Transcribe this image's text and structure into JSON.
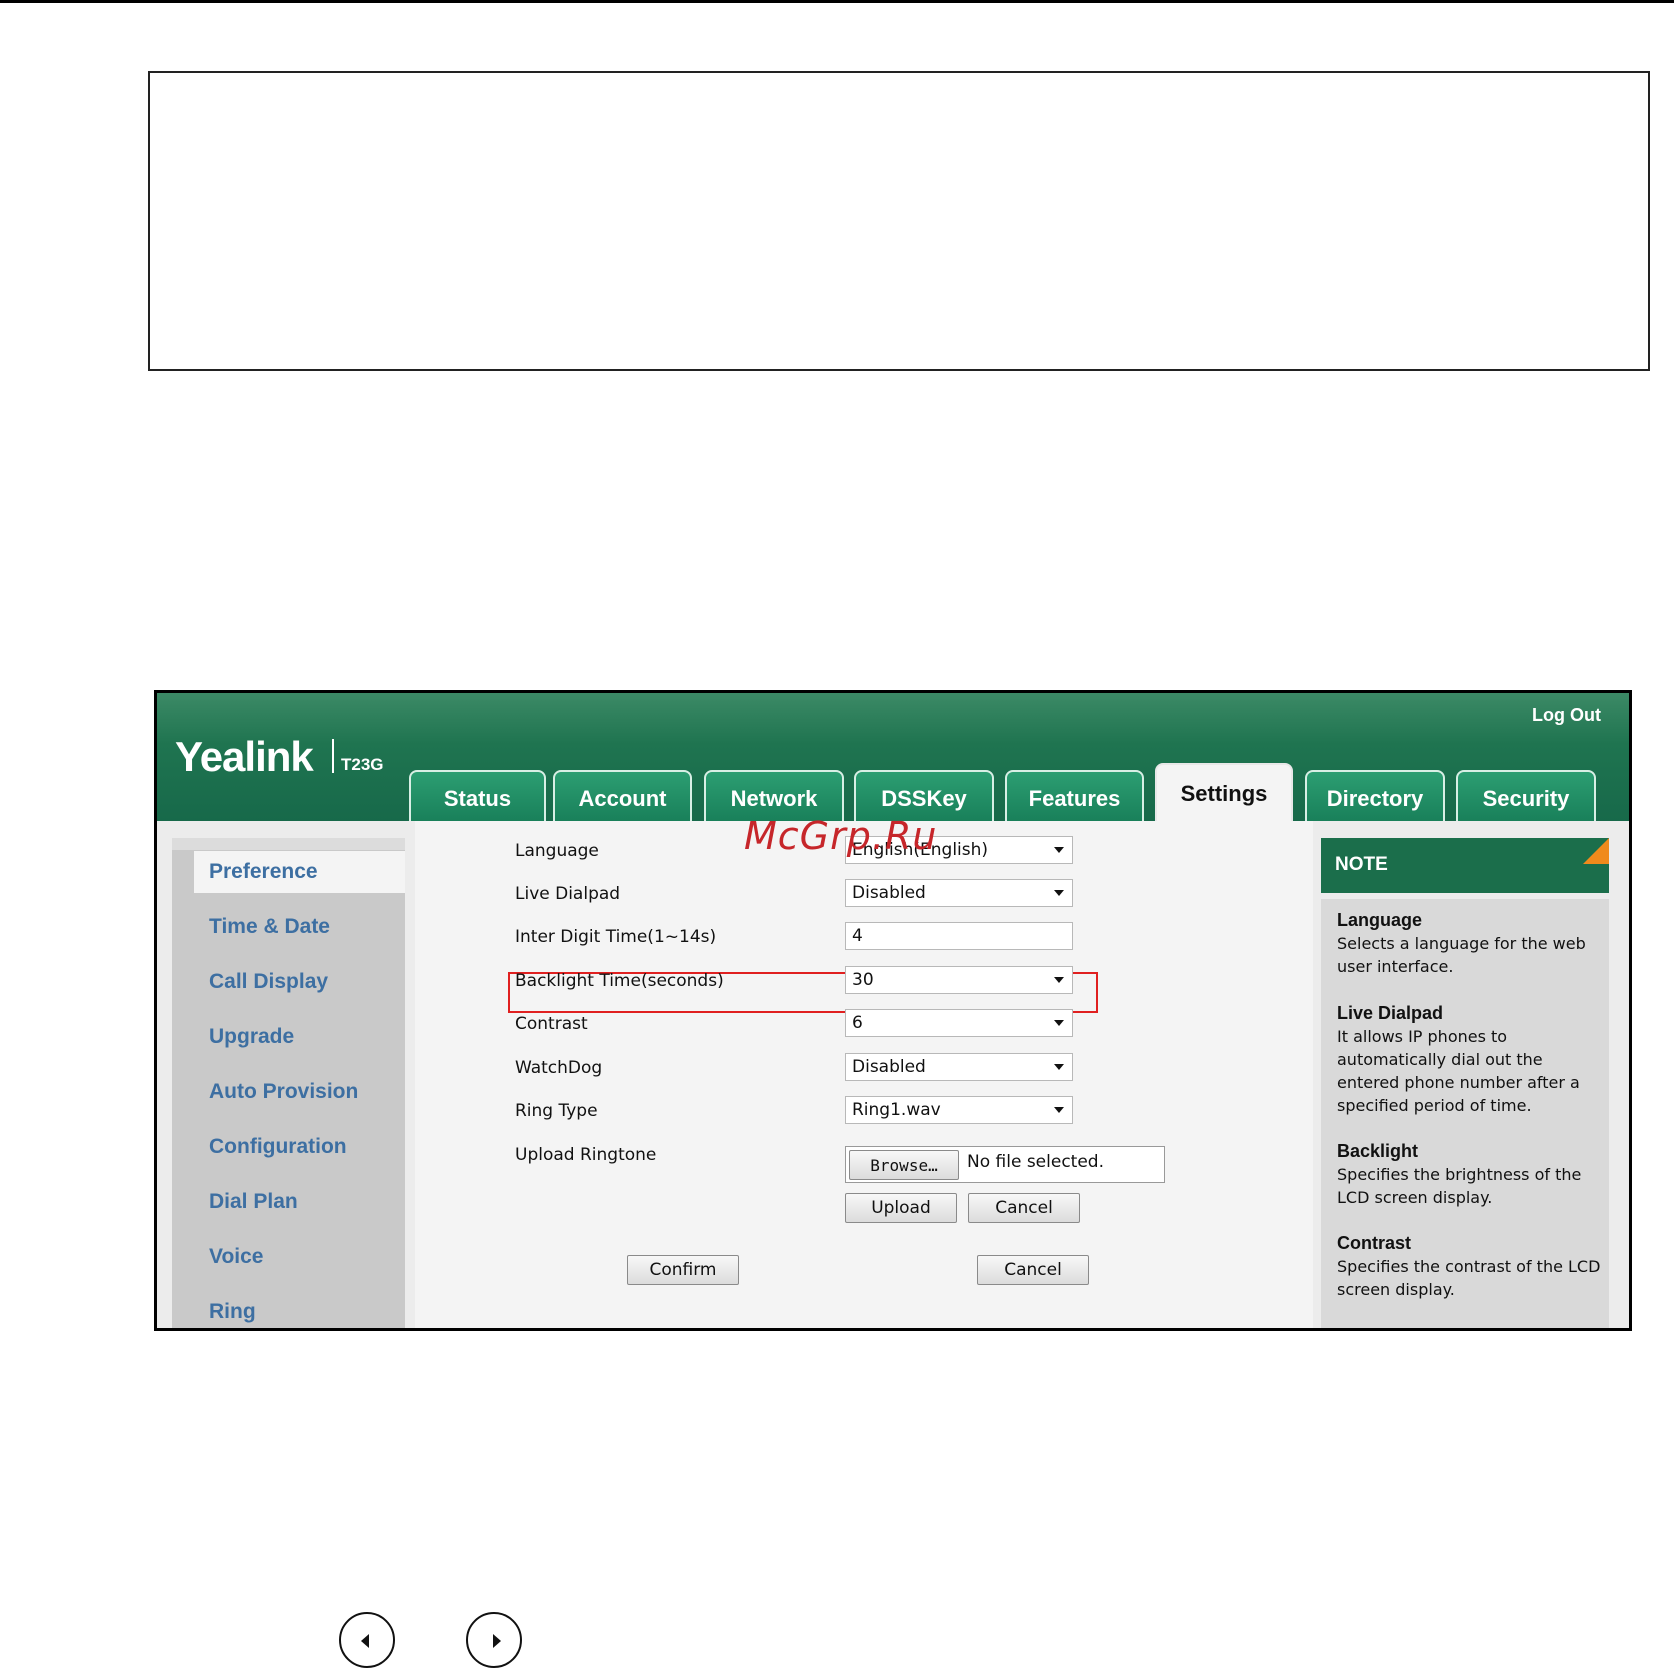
{
  "header": {
    "logo": "Yealink",
    "model": "T23G",
    "logout": "Log Out",
    "tabs": [
      "Status",
      "Account",
      "Network",
      "DSSKey",
      "Features",
      "Settings",
      "Directory",
      "Security"
    ],
    "active_tab": "Settings"
  },
  "sidebar": {
    "items": [
      "Preference",
      "Time & Date",
      "Call Display",
      "Upgrade",
      "Auto Provision",
      "Configuration",
      "Dial Plan",
      "Voice",
      "Ring"
    ],
    "active": "Preference"
  },
  "form": {
    "language": {
      "label": "Language",
      "value": "English(English)"
    },
    "live_dialpad": {
      "label": "Live Dialpad",
      "value": "Disabled"
    },
    "inter_digit": {
      "label": "Inter Digit Time(1~14s)",
      "value": "4"
    },
    "backlight": {
      "label": "Backlight Time(seconds)",
      "value": "30"
    },
    "contrast": {
      "label": "Contrast",
      "value": "6"
    },
    "watchdog": {
      "label": "WatchDog",
      "value": "Disabled"
    },
    "ring_type": {
      "label": "Ring Type",
      "value": "Ring1.wav"
    },
    "upload_ringtone": {
      "label": "Upload Ringtone",
      "browse": "Browse…",
      "file_status": "No file selected.",
      "upload": "Upload",
      "cancel": "Cancel"
    },
    "confirm": "Confirm",
    "cancel": "Cancel"
  },
  "note": {
    "title": "NOTE",
    "sections": [
      {
        "heading": "Language",
        "text": "Selects a language for the web user interface."
      },
      {
        "heading": "Live Dialpad",
        "text": "It allows IP phones to automatically dial out the entered phone number after a specified period of time."
      },
      {
        "heading": "Backlight",
        "text": "Specifies the brightness of the LCD screen display."
      },
      {
        "heading": "Contrast",
        "text": "Specifies the contrast of the LCD screen display."
      }
    ]
  },
  "watermark": "McGrp.Ru",
  "colors": {
    "brand_green": "#1b6e4b",
    "highlight_red": "#e02020",
    "sidebar_link": "#3d6fa2",
    "note_corner": "#f08a1c"
  },
  "icons": [
    "prev-page-icon",
    "next-page-icon",
    "dropdown-caret-icon"
  ]
}
